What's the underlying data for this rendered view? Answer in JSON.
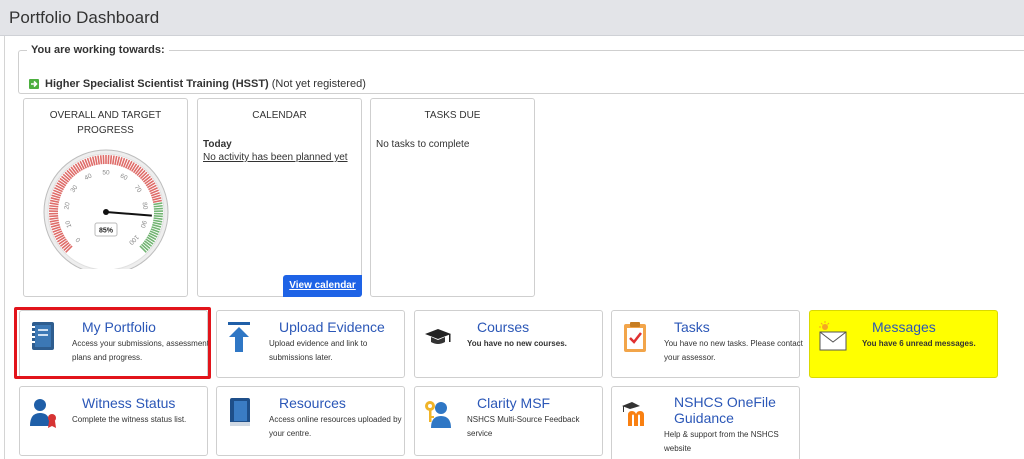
{
  "header": {
    "title": "Portfolio Dashboard"
  },
  "working": {
    "legend": "You are working towards:",
    "qualification": "Higher Specialist Scientist Training (HSST)",
    "status": "(Not yet registered)",
    "icon": "arrow-right-icon"
  },
  "progress": {
    "title": "OVERALL AND TARGET PROGRESS",
    "value_percent": 85,
    "label": "85%",
    "ticks": [
      "0",
      "10",
      "20",
      "30",
      "40",
      "50",
      "60",
      "70",
      "80",
      "90",
      "100"
    ]
  },
  "calendar": {
    "title": "CALENDAR",
    "today_label": "Today",
    "empty_text": "No activity has been planned yet",
    "button": "View calendar"
  },
  "tasks_due": {
    "title": "TASKS DUE",
    "empty_text": "No tasks to complete"
  },
  "tiles": {
    "my_portfolio": {
      "title": "My Portfolio",
      "desc": "Access your submissions, assessment plans and progress.",
      "icon": "book-icon"
    },
    "upload_evidence": {
      "title": "Upload Evidence",
      "desc": "Upload evidence and link to submissions later.",
      "icon": "upload-arrow-icon"
    },
    "courses": {
      "title": "Courses",
      "desc": "You have no new courses.",
      "icon": "graduation-cap-icon"
    },
    "tasks": {
      "title": "Tasks",
      "desc": "You have no new tasks. Please contact your assessor.",
      "icon": "clipboard-check-icon"
    },
    "messages": {
      "title": "Messages",
      "desc": "You have 6 unread messages.",
      "icon": "envelope-icon"
    },
    "witness_status": {
      "title": "Witness Status",
      "desc": "Complete the witness status list.",
      "icon": "user-award-icon"
    },
    "resources": {
      "title": "Resources",
      "desc": "Access online resources uploaded by your centre.",
      "icon": "book-blue-icon"
    },
    "clarity_msf": {
      "title": "Clarity MSF",
      "desc": "NSHCS Multi-Source Feedback service",
      "icon": "user-key-icon"
    },
    "onefile_guidance": {
      "title": "NSHCS OneFile Guidance",
      "desc": "Help & support from the NSHCS website",
      "icon": "moodle-icon"
    }
  },
  "colors": {
    "accent": "#2b57b7",
    "highlight": "#e2141b",
    "messages_bg": "#ffff00",
    "button": "#1e63e6"
  }
}
